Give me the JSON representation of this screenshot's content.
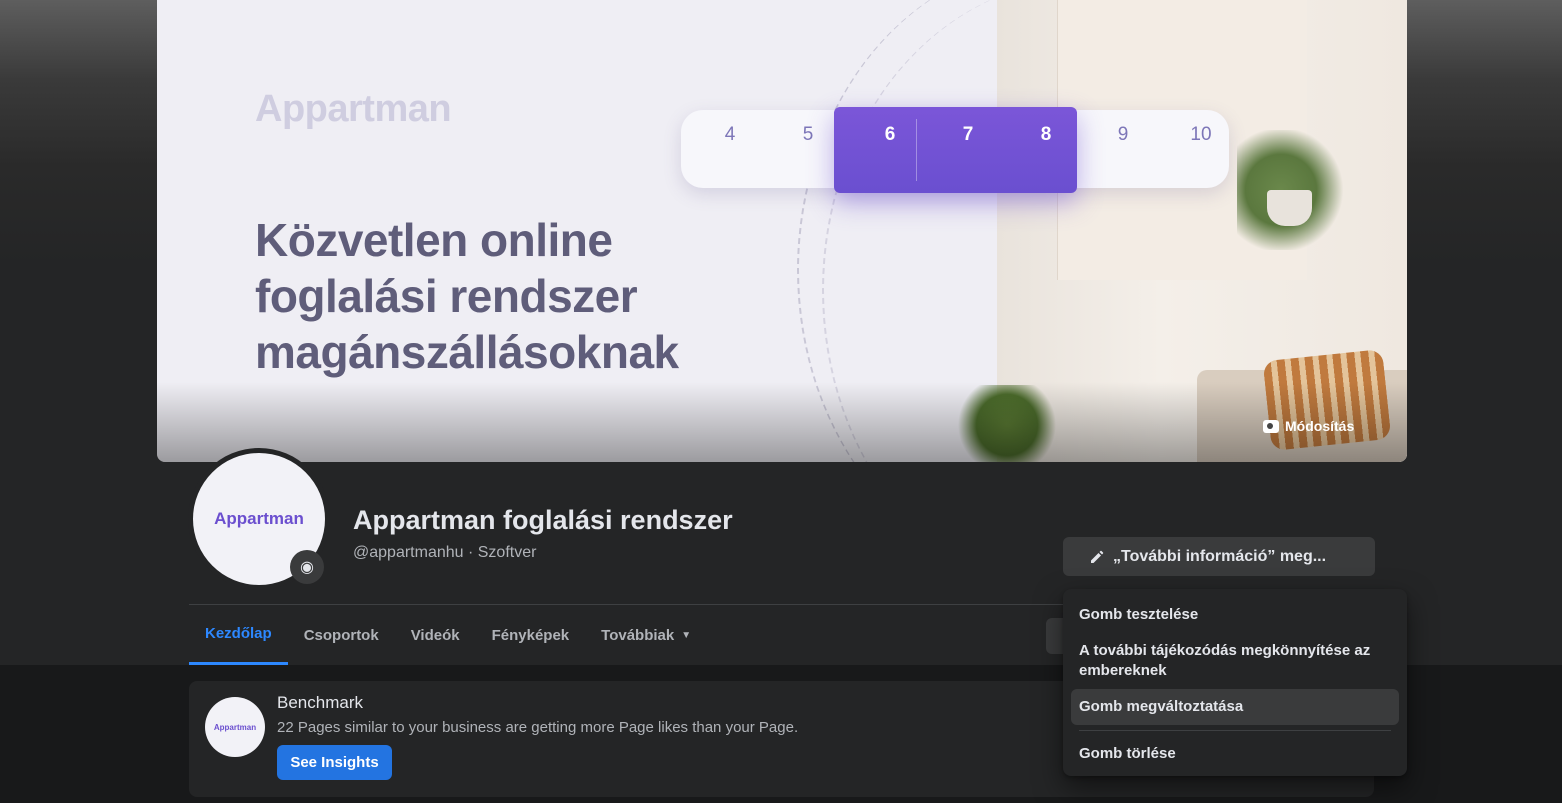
{
  "cover": {
    "brand": "Appartman",
    "headline_lines": [
      "Közvetlen online",
      "foglalási rendszer",
      "magánszállásoknak"
    ],
    "numbers": [
      "4",
      "5",
      "6",
      "7",
      "8",
      "9",
      "10"
    ],
    "edit_label": "Módosítás"
  },
  "profile": {
    "avatar_text": "Appartman",
    "name": "Appartman foglalási rendszer",
    "subtitle": "@appartmanhu · Szoftver"
  },
  "cta_button": {
    "label": "„További információ” meg..."
  },
  "tabs": [
    {
      "label": "Kezdőlap",
      "active": true
    },
    {
      "label": "Csoportok",
      "active": false
    },
    {
      "label": "Videók",
      "active": false
    },
    {
      "label": "Fényképek",
      "active": false
    },
    {
      "label": "Továbbiak",
      "active": false
    }
  ],
  "benchmark": {
    "logo_text": "Appartman",
    "title": "Benchmark",
    "description": "22 Pages similar to your business are getting more Page likes than your Page.",
    "button_label": "See Insights"
  },
  "dropdown": {
    "items": [
      "Gomb tesztelése",
      "A további tájékozódás megkönnyítése az embereknek",
      "Gomb megváltoztatása",
      "Gomb törlése"
    ]
  },
  "colors": {
    "accent": "#2d88ff",
    "button_blue": "#2374e1",
    "brand_purple": "#6b4fcf",
    "surface": "#242526",
    "background": "#18191a"
  }
}
